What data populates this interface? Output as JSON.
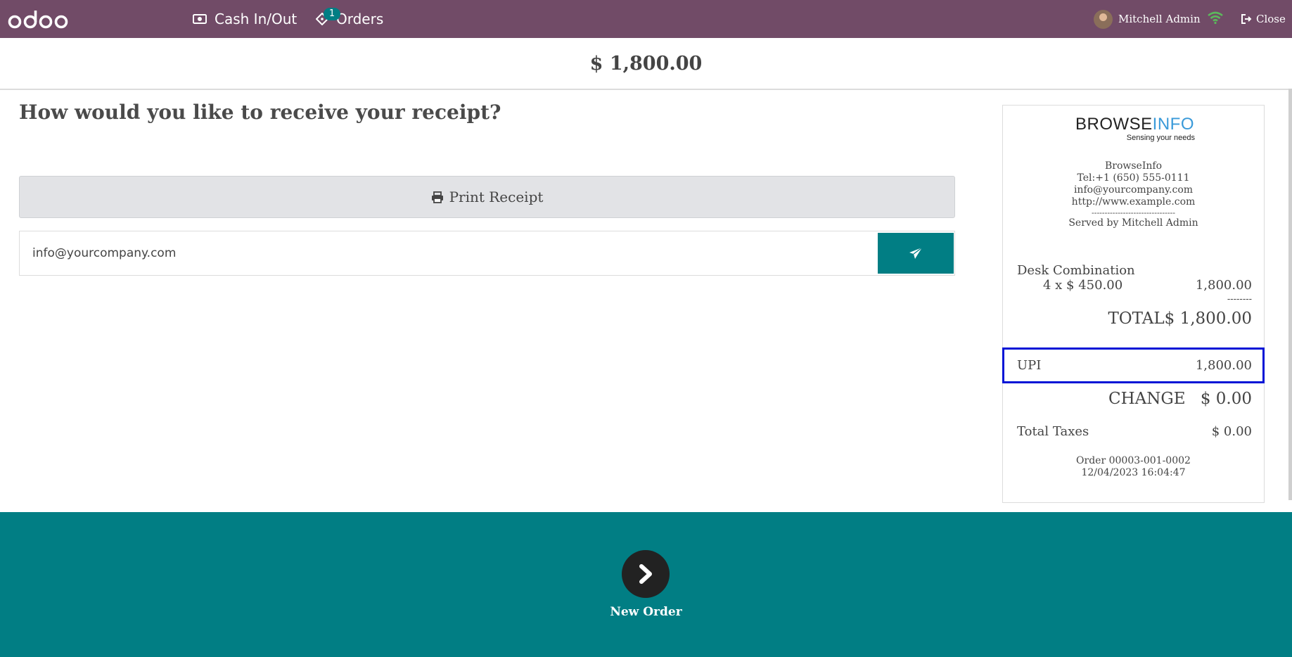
{
  "navbar": {
    "logo_text": "odoo",
    "cash_label": "Cash In/Out",
    "orders_label": "Orders",
    "orders_badge": "1",
    "user_name": "Mitchell Admin",
    "close_label": "Close",
    "colors": {
      "navbar_bg": "#714B67",
      "badge_bg": "#017e84",
      "wifi": "#5cb85c"
    }
  },
  "amount_total": "$ 1,800.00",
  "receipt_question": "How would you like to receive your receipt?",
  "print_button_label": "Print Receipt",
  "email": {
    "value": "info@yourcompany.com"
  },
  "receipt": {
    "logo_text_dark": "BROWSE",
    "logo_text_accent": "INFO",
    "logo_tagline": "Sensing your needs",
    "company_name": "BrowseInfo",
    "tel": "Tel:+1 (650) 555-0111",
    "email": "info@yourcompany.com",
    "website": "http://www.example.com",
    "separator": "--------------------------------",
    "served_by": "Served by Mitchell Admin",
    "line_item": {
      "product": "Desk Combination",
      "qty_price": "4 x $ 450.00",
      "subtotal": "1,800.00"
    },
    "dashes": "--------",
    "total_label": "TOTAL",
    "total_value": "$ 1,800.00",
    "payment": {
      "method": "UPI",
      "amount": "1,800.00"
    },
    "change_label": "CHANGE",
    "change_value": "$ 0.00",
    "taxes_label": "Total Taxes",
    "taxes_value": "$ 0.00",
    "order_ref": "Order 00003-001-0002",
    "order_date": "12/04/2023 16:04:47"
  },
  "next_button_label": "New Order",
  "colors": {
    "primary": "#017e84",
    "highlight_border": "#0015d6"
  }
}
